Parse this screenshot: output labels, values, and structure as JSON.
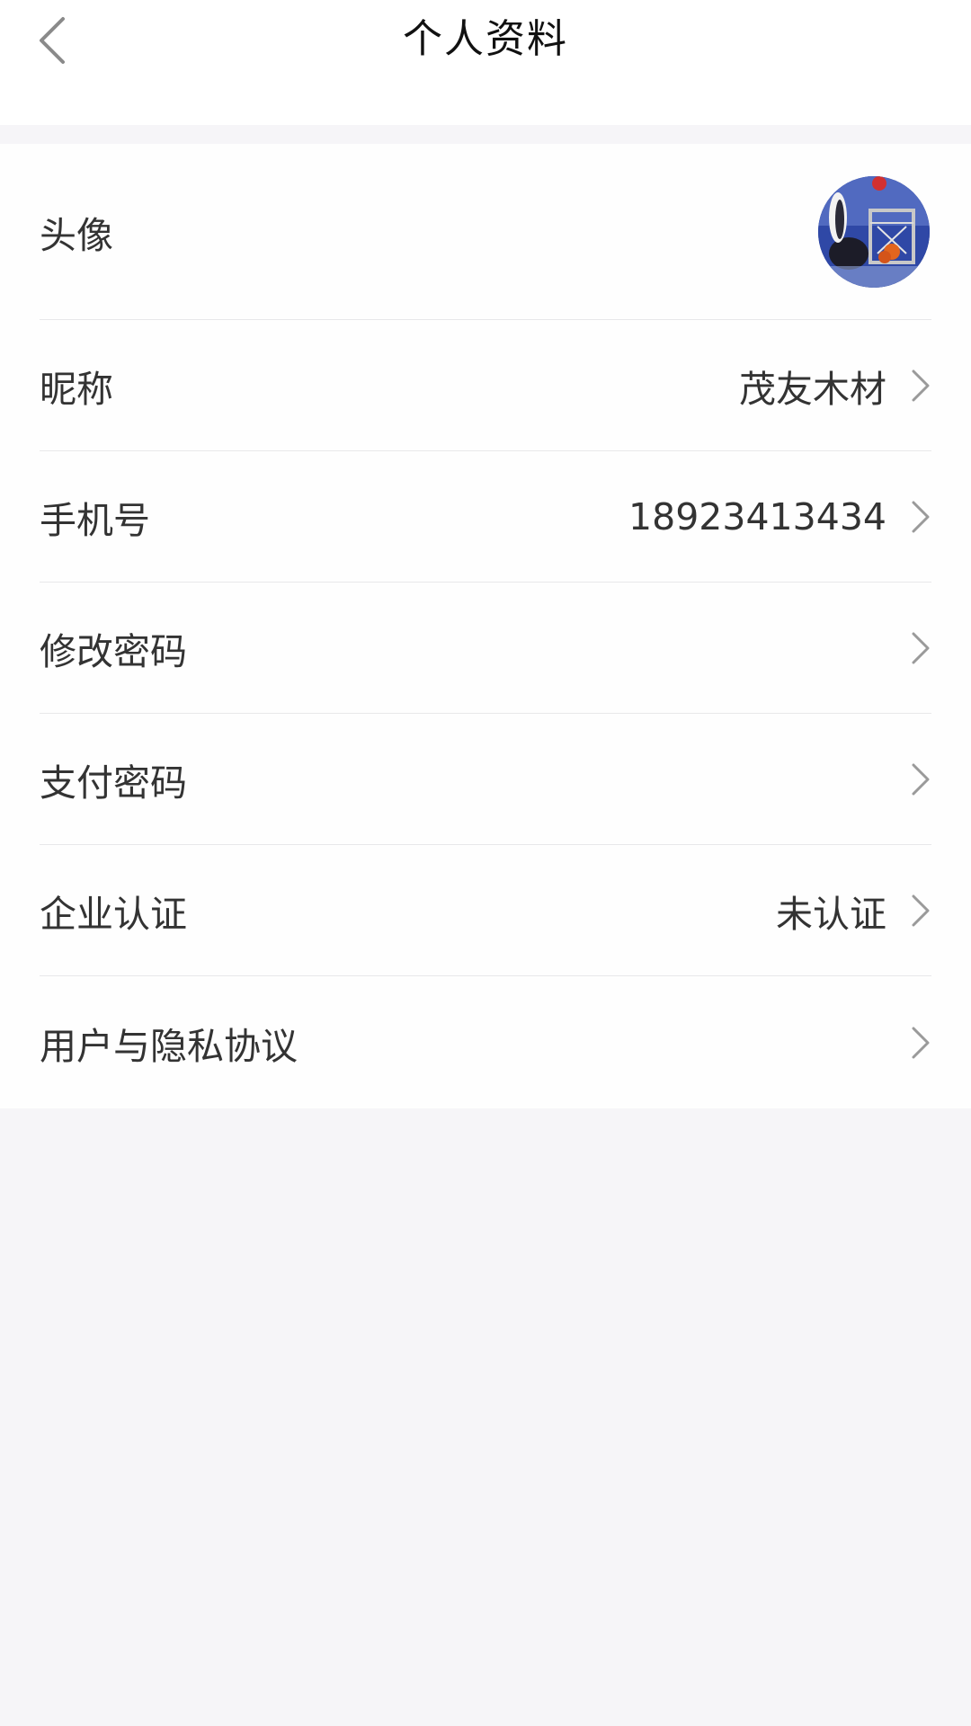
{
  "header": {
    "title": "个人资料",
    "back_icon": "chevron-left-icon"
  },
  "profile": {
    "avatar": {
      "label": "头像",
      "image": "avatar-photo"
    },
    "nickname": {
      "label": "昵称",
      "value": "茂友木材"
    },
    "phone": {
      "label": "手机号",
      "value": "18923413434"
    },
    "change_password": {
      "label": "修改密码"
    },
    "payment_password": {
      "label": "支付密码"
    },
    "enterprise_cert": {
      "label": "企业认证",
      "value": "未认证"
    },
    "privacy_agreement": {
      "label": "用户与隐私协议"
    }
  },
  "colors": {
    "background": "#f6f5f8",
    "card": "#fefefe",
    "text": "#333333",
    "chevron": "#9a9a9a",
    "divider": "#e8e8ea"
  }
}
